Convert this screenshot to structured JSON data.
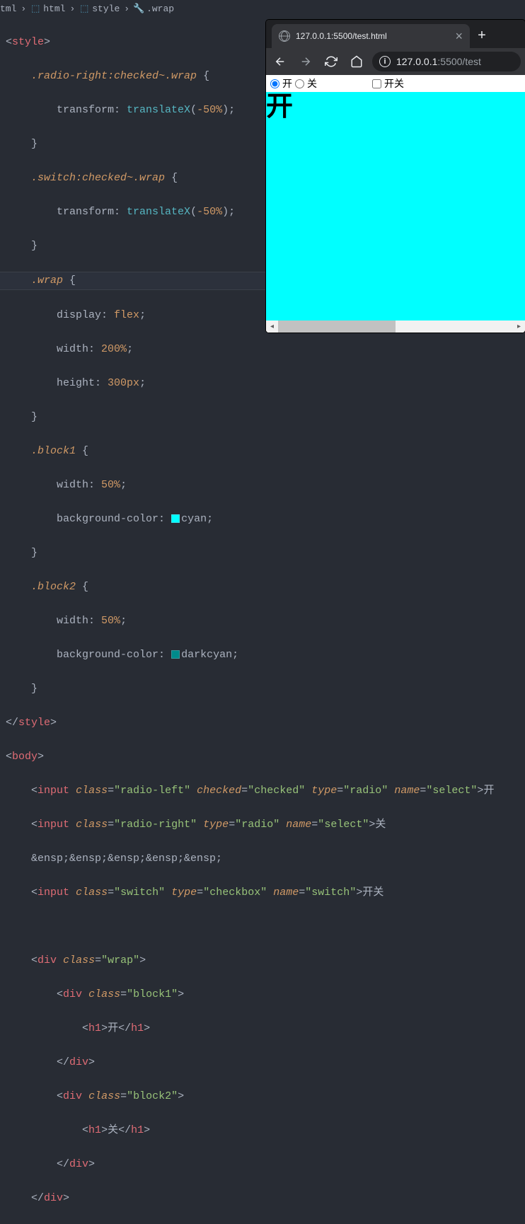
{
  "breadcrumb": [
    {
      "icon": "file",
      "label": "tml"
    },
    {
      "icon": "brackets",
      "label": "html"
    },
    {
      "icon": "brackets",
      "label": "style"
    },
    {
      "icon": "wrench",
      "label": ".wrap"
    }
  ],
  "code": {
    "style_open": "style",
    "style_close": "style",
    "body_open": "body",
    "rules": [
      {
        "selector": ".radio-right:checked~.wrap",
        "decl": {
          "prop": "transform",
          "func": "translateX",
          "arg": "-50%"
        }
      },
      {
        "selector": ".switch:checked~.wrap",
        "decl": {
          "prop": "transform",
          "func": "translateX",
          "arg": "-50%"
        }
      },
      {
        "selector": ".wrap",
        "decls": [
          {
            "prop": "display",
            "val": "flex"
          },
          {
            "prop": "width",
            "val": "200%"
          },
          {
            "prop": "height",
            "val": "300px"
          }
        ]
      },
      {
        "selector": ".block1",
        "decls": [
          {
            "prop": "width",
            "val": "50%"
          },
          {
            "prop": "background-color",
            "color": "#00ffff",
            "name": "cyan"
          }
        ]
      },
      {
        "selector": ".block2",
        "decls": [
          {
            "prop": "width",
            "val": "50%"
          },
          {
            "prop": "background-color",
            "color": "#008b8b",
            "name": "darkcyan"
          }
        ]
      }
    ],
    "inputs": [
      {
        "class": "radio-left",
        "checked": "checked",
        "type": "radio",
        "name": "select",
        "text": "开"
      },
      {
        "class": "radio-right",
        "type": "radio",
        "name": "select",
        "text": "关"
      },
      {
        "class": "switch",
        "type": "checkbox",
        "name": "switch",
        "text": "开关"
      }
    ],
    "spaces_line": "&ensp;&ensp;&ensp;&ensp;&ensp;",
    "wrap": {
      "class": "wrap",
      "b1": {
        "class": "block1",
        "h1": "开"
      },
      "b2": {
        "class": "block2",
        "h1": "关"
      }
    }
  },
  "browser": {
    "tab_title": "127.0.0.1:5500/test.html",
    "url_host": "127.0.0.1",
    "url_path": ":5500/test",
    "controls": {
      "radio1_label": "开",
      "radio2_label": "关",
      "checkbox_label": "开关"
    },
    "block_h1": "开"
  }
}
